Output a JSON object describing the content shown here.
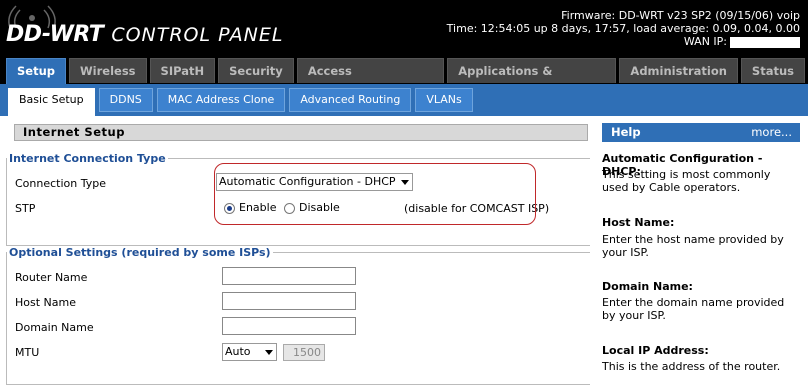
{
  "header": {
    "brand": "DD-WRT",
    "subtitle": "CONTROL PANEL",
    "firmware": "Firmware: DD-WRT v23 SP2 (09/15/06) voip",
    "time": "Time: 12:54:05 up 8 days, 17:57, load average: 0.09, 0.04, 0.00",
    "wan_ip_label": "WAN IP:"
  },
  "main_tabs": [
    "Setup",
    "Wireless",
    "SIPatH",
    "Security",
    "Access Restrictions",
    "Applications & Gaming",
    "Administration",
    "Status"
  ],
  "sub_tabs": [
    "Basic Setup",
    "DDNS",
    "MAC Address Clone",
    "Advanced Routing",
    "VLANs"
  ],
  "section_title": "Internet Setup",
  "connection": {
    "legend": "Internet Connection Type",
    "type_label": "Connection Type",
    "type_value": "Automatic Configuration - DHCP",
    "stp_label": "STP",
    "enable_label": "Enable",
    "disable_label": "Disable",
    "note": "(disable for COMCAST ISP)"
  },
  "optional": {
    "legend": "Optional Settings (required by some ISPs)",
    "router_name_label": "Router Name",
    "host_name_label": "Host Name",
    "domain_name_label": "Domain Name",
    "mtu_label": "MTU",
    "mtu_mode": "Auto",
    "mtu_value": "1500"
  },
  "help": {
    "title": "Help",
    "more": "more...",
    "items": [
      {
        "title": "Automatic Configuration - DHCP:",
        "text": "This setting is most commonly used by Cable operators."
      },
      {
        "title": "Host Name:",
        "text": "Enter the host name provided by your ISP."
      },
      {
        "title": "Domain Name:",
        "text": "Enter the domain name provided by your ISP."
      },
      {
        "title": "Local IP Address:",
        "text": "This is the address of the router."
      }
    ]
  },
  "colors": {
    "accent": "#2f6fb6",
    "highlight": "#c0282a",
    "legend": "#1f4f96"
  }
}
